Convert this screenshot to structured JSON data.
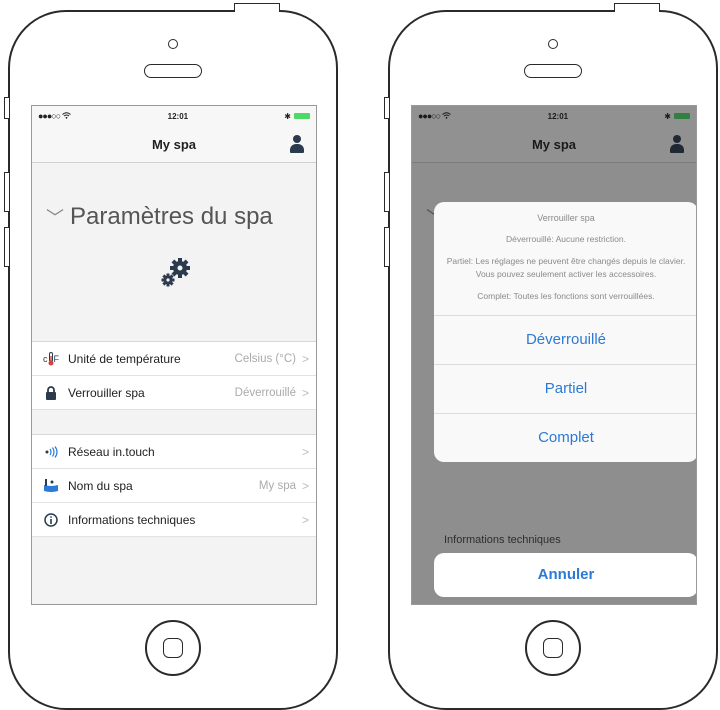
{
  "status_bar": {
    "time": "12:01",
    "signal": "●●●○○",
    "wifi": "wifi-icon",
    "bluetooth": "✱"
  },
  "navbar": {
    "title": "My spa"
  },
  "section": {
    "title": "Paramètres du spa"
  },
  "list": {
    "group1": [
      {
        "icon": "thermometer-icon",
        "label": "Unité de température",
        "value": "Celsius (°C)"
      },
      {
        "icon": "lock-icon",
        "label": "Verrouiller spa",
        "value": "Déverrouillé"
      }
    ],
    "group2": [
      {
        "icon": "wifi-signal-icon",
        "label": "Réseau in.touch",
        "value": ""
      },
      {
        "icon": "spa-icon",
        "label": "Nom du spa",
        "value": "My spa"
      },
      {
        "icon": "info-icon",
        "label": "Informations techniques",
        "value": ""
      }
    ]
  },
  "action_sheet": {
    "title": "Verrouiller spa",
    "messages": [
      "Déverrouillé: Aucune restriction.",
      "Partiel: Les réglages ne peuvent être changés depuis le clavier. Vous pouvez seulement activer les accessoires.",
      "Complet: Toutes les fonctions sont verrouillées."
    ],
    "options": [
      "Déverrouillé",
      "Partiel",
      "Complet"
    ],
    "cancel": "Annuler"
  },
  "colors": {
    "accent": "#2c7ad6",
    "icon": "#2b3a4d",
    "battery": "#4cd964"
  }
}
